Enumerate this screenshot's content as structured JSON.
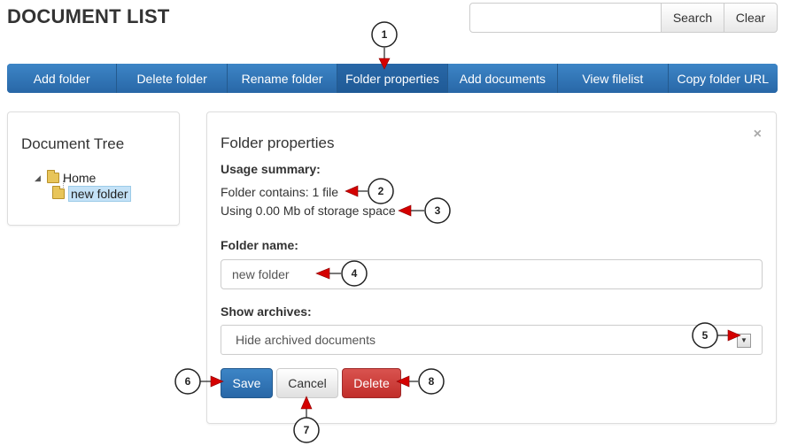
{
  "header": {
    "title": "DOCUMENT LIST",
    "search": {
      "value": "",
      "placeholder": "",
      "search_label": "Search",
      "clear_label": "Clear"
    }
  },
  "toolbar": {
    "add_folder": "Add folder",
    "delete_folder": "Delete folder",
    "rename_folder": "Rename folder",
    "folder_properties": "Folder properties",
    "add_documents": "Add documents",
    "view_filelist": "View filelist",
    "copy_folder_url": "Copy folder URL"
  },
  "tree": {
    "title": "Document Tree",
    "home": "Home",
    "child": "new folder"
  },
  "properties": {
    "title": "Folder properties",
    "close": "×",
    "usage_label": "Usage summary:",
    "contains": "Folder contains: 1 file",
    "storage": "Using 0.00 Mb of storage space",
    "folder_name_label": "Folder name:",
    "folder_name_value": "new folder",
    "show_archives_label": "Show archives:",
    "show_archives_selected": "Hide archived documents",
    "save": "Save",
    "cancel": "Cancel",
    "delete": "Delete"
  },
  "callouts": [
    "1",
    "2",
    "3",
    "4",
    "5",
    "6",
    "7",
    "8"
  ],
  "colors": {
    "primary": "#2f6fad",
    "danger": "#d9534f",
    "arrow": "#d40000"
  }
}
